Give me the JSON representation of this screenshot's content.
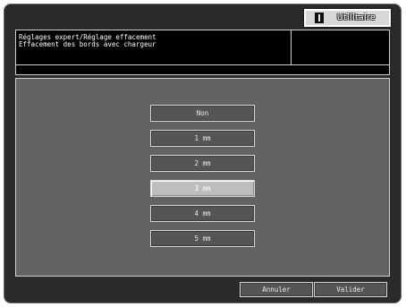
{
  "utility_tab": {
    "label": "Utilitaire"
  },
  "header": {
    "title_line1": "Réglages expert/Réglage effacement",
    "title_line2": "Effacement des bords avec chargeur"
  },
  "options": {
    "selected_index": 3,
    "items": [
      {
        "label": "Non"
      },
      {
        "label": "1 mm"
      },
      {
        "label": "2 mm"
      },
      {
        "label": "3 mm"
      },
      {
        "label": "4 mm"
      },
      {
        "label": "5 mm"
      }
    ]
  },
  "footer": {
    "cancel_label": "Annuler",
    "ok_label": "Valider"
  }
}
